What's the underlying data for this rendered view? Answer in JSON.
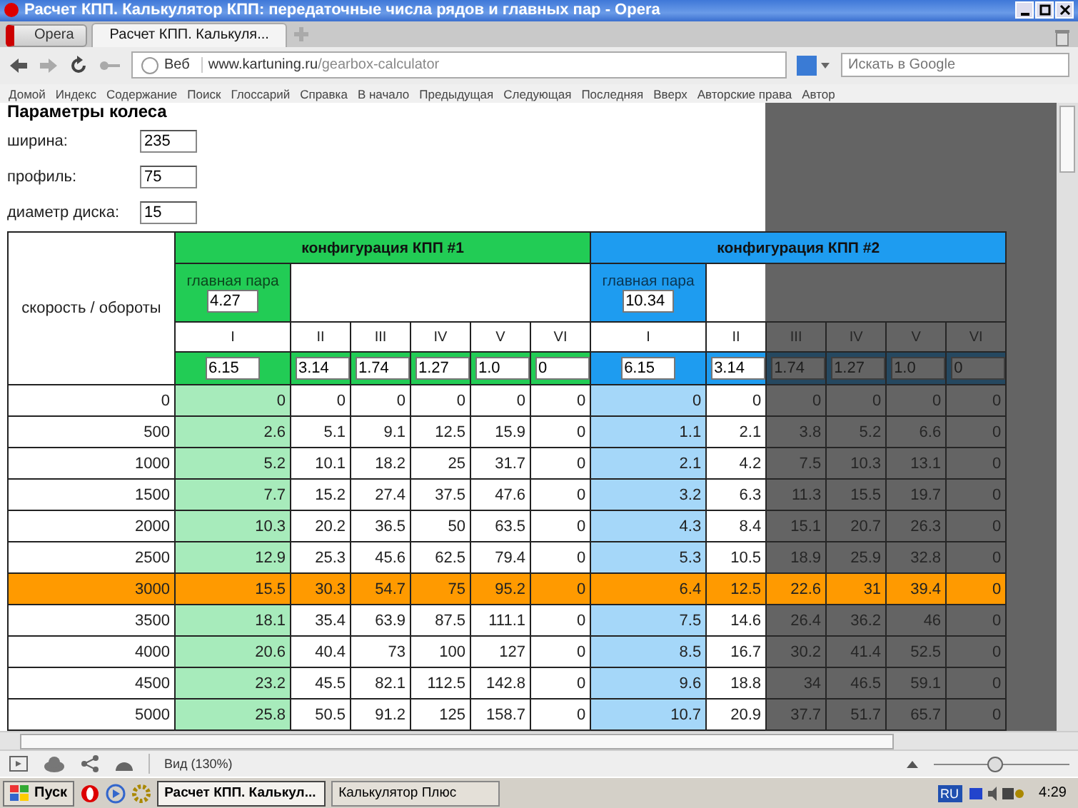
{
  "window": {
    "title": "Расчет КПП. Калькулятор КПП: передаточные числа рядов и главных пар - Opera"
  },
  "menu_button": "Opera",
  "tabs": [
    {
      "label": "Расчет КПП. Калькуля...",
      "selected": true
    }
  ],
  "address": {
    "prefix": "Веб",
    "url_host": "www.kartuning.ru",
    "url_path": "/gearbox-calculator"
  },
  "search": {
    "placeholder": "Искать в Google"
  },
  "nav_links": [
    "Домой",
    "Индекс",
    "Содержание",
    "Поиск",
    "Глоссарий",
    "Справка",
    "В начало",
    "Предыдущая",
    "Следующая",
    "Последняя",
    "Вверх",
    "Авторские права",
    "Автор"
  ],
  "page": {
    "heading": "Параметры колеса",
    "params": [
      {
        "label": "ширина:",
        "value": "235"
      },
      {
        "label": "профиль:",
        "value": "75"
      },
      {
        "label": "диаметр диска:",
        "value": "15"
      }
    ],
    "table": {
      "speed_header": "скорость / обороты",
      "configs": [
        {
          "title": "конфигурация КПП #1",
          "color": "#22cc55",
          "main_pair_label": "главная пара",
          "main_pair": "4.27",
          "gears": [
            "I",
            "II",
            "III",
            "IV",
            "V",
            "VI"
          ],
          "ratios": [
            "6.15",
            "3.14",
            "1.74",
            "1.27",
            "1.0",
            "0"
          ]
        },
        {
          "title": "конфигурация КПП #2",
          "color": "#1e9cf0",
          "main_pair_label": "главная пара",
          "main_pair": "10.34",
          "gears": [
            "I",
            "II",
            "III",
            "IV",
            "V",
            "VI"
          ],
          "ratios": [
            "6.15",
            "3.14",
            "1.74",
            "1.27",
            "1.0",
            "0"
          ]
        }
      ],
      "rows": [
        {
          "rpm": "0",
          "highlighted": false,
          "values": [
            [
              "0",
              "0",
              "0",
              "0",
              "0",
              "0"
            ],
            [
              "0",
              "0",
              "0",
              "0",
              "0",
              "0"
            ]
          ]
        },
        {
          "rpm": "500",
          "highlighted": false,
          "values": [
            [
              "2.6",
              "5.1",
              "9.1",
              "12.5",
              "15.9",
              "0"
            ],
            [
              "1.1",
              "2.1",
              "3.8",
              "5.2",
              "6.6",
              "0"
            ]
          ]
        },
        {
          "rpm": "1000",
          "highlighted": false,
          "values": [
            [
              "5.2",
              "10.1",
              "18.2",
              "25",
              "31.7",
              "0"
            ],
            [
              "2.1",
              "4.2",
              "7.5",
              "10.3",
              "13.1",
              "0"
            ]
          ]
        },
        {
          "rpm": "1500",
          "highlighted": false,
          "values": [
            [
              "7.7",
              "15.2",
              "27.4",
              "37.5",
              "47.6",
              "0"
            ],
            [
              "3.2",
              "6.3",
              "11.3",
              "15.5",
              "19.7",
              "0"
            ]
          ]
        },
        {
          "rpm": "2000",
          "highlighted": false,
          "values": [
            [
              "10.3",
              "20.2",
              "36.5",
              "50",
              "63.5",
              "0"
            ],
            [
              "4.3",
              "8.4",
              "15.1",
              "20.7",
              "26.3",
              "0"
            ]
          ]
        },
        {
          "rpm": "2500",
          "highlighted": false,
          "values": [
            [
              "12.9",
              "25.3",
              "45.6",
              "62.5",
              "79.4",
              "0"
            ],
            [
              "5.3",
              "10.5",
              "18.9",
              "25.9",
              "32.8",
              "0"
            ]
          ]
        },
        {
          "rpm": "3000",
          "highlighted": true,
          "values": [
            [
              "15.5",
              "30.3",
              "54.7",
              "75",
              "95.2",
              "0"
            ],
            [
              "6.4",
              "12.5",
              "22.6",
              "31",
              "39.4",
              "0"
            ]
          ]
        },
        {
          "rpm": "3500",
          "highlighted": false,
          "values": [
            [
              "18.1",
              "35.4",
              "63.9",
              "87.5",
              "111.1",
              "0"
            ],
            [
              "7.5",
              "14.6",
              "26.4",
              "36.2",
              "46",
              "0"
            ]
          ]
        },
        {
          "rpm": "4000",
          "highlighted": false,
          "values": [
            [
              "20.6",
              "40.4",
              "73",
              "100",
              "127",
              "0"
            ],
            [
              "8.5",
              "16.7",
              "30.2",
              "41.4",
              "52.5",
              "0"
            ]
          ]
        },
        {
          "rpm": "4500",
          "highlighted": false,
          "values": [
            [
              "23.2",
              "45.5",
              "82.1",
              "112.5",
              "142.8",
              "0"
            ],
            [
              "9.6",
              "18.8",
              "34",
              "46.5",
              "59.1",
              "0"
            ]
          ]
        },
        {
          "rpm": "5000",
          "highlighted": false,
          "values": [
            [
              "25.8",
              "50.5",
              "91.2",
              "125",
              "158.7",
              "0"
            ],
            [
              "10.7",
              "20.9",
              "37.7",
              "51.7",
              "65.7",
              "0"
            ]
          ]
        }
      ]
    }
  },
  "status_bar": {
    "zoom_text": "Вид (130%)",
    "zoom_slider": {
      "level": 0.45
    }
  },
  "taskbar": {
    "start": "Пуск",
    "windows": [
      {
        "label": "Расчет КПП. Калькул...",
        "selected": true
      },
      {
        "label": "Калькулятор Плюс",
        "selected": false
      }
    ],
    "language": "RU",
    "clock": "4:29"
  }
}
